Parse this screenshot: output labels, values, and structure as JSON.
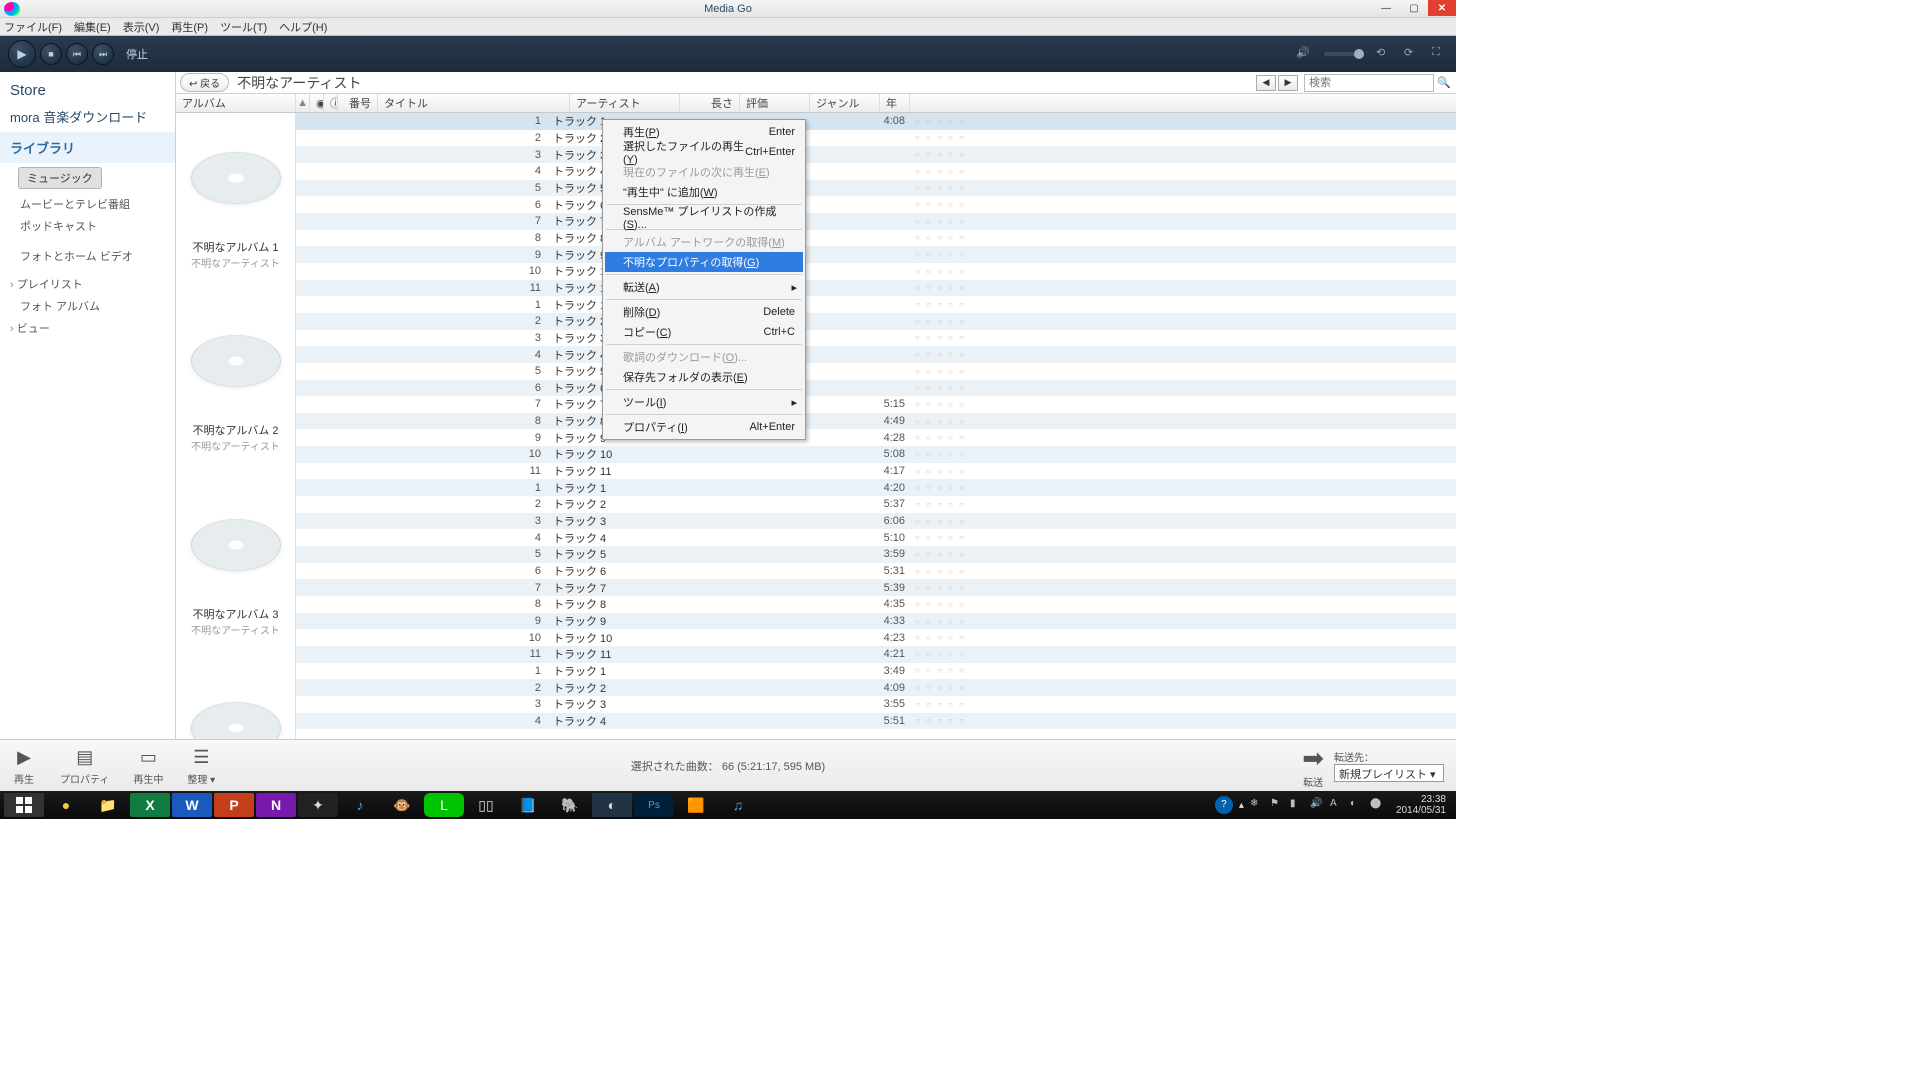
{
  "window": {
    "title": "Media Go"
  },
  "menu": {
    "file": "ファイル(F)",
    "edit": "編集(E)",
    "view": "表示(V)",
    "play": "再生(P)",
    "tool": "ツール(T)",
    "help": "ヘルプ(H)"
  },
  "player": {
    "status": "停止"
  },
  "sidebar": {
    "store": "Store",
    "mora": "mora 音楽ダウンロード",
    "library": "ライブラリ",
    "music": "ミュージック",
    "items": [
      "ムービーとテレビ番組",
      "ポッドキャスト",
      "",
      "フォトとホーム ビデオ"
    ],
    "exp": [
      "プレイリスト",
      "フォト アルバム",
      "ビュー"
    ]
  },
  "breadcrumb": {
    "back": "↩ 戻る",
    "artist": "不明なアーティスト",
    "search_ph": "検索"
  },
  "columns": {
    "album": "アルバム",
    "num": "番号",
    "title": "タイトル",
    "artist": "アーティスト",
    "len": "長さ",
    "rating": "評価",
    "genre": "ジャンル",
    "year": "年"
  },
  "albums": [
    {
      "name": "不明なアルバム 1",
      "artist": "不明なアーティスト",
      "tracks": [
        {
          "n": 1,
          "t": "トラック 1",
          "d": "4:08"
        },
        {
          "n": 2,
          "t": "トラック 2",
          "d": ""
        },
        {
          "n": 3,
          "t": "トラック 3",
          "d": ""
        },
        {
          "n": 4,
          "t": "トラック 4",
          "d": ""
        },
        {
          "n": 5,
          "t": "トラック 5",
          "d": ""
        },
        {
          "n": 6,
          "t": "トラック 6",
          "d": ""
        },
        {
          "n": 7,
          "t": "トラック 7",
          "d": ""
        },
        {
          "n": 8,
          "t": "トラック 8",
          "d": ""
        },
        {
          "n": 9,
          "t": "トラック 9",
          "d": ""
        },
        {
          "n": 10,
          "t": "トラック 10",
          "d": ""
        },
        {
          "n": 11,
          "t": "トラック 11",
          "d": ""
        }
      ]
    },
    {
      "name": "不明なアルバム 2",
      "artist": "不明なアーティスト",
      "tracks": [
        {
          "n": 1,
          "t": "トラック 1",
          "d": ""
        },
        {
          "n": 2,
          "t": "トラック 2",
          "d": ""
        },
        {
          "n": 3,
          "t": "トラック 3",
          "d": ""
        },
        {
          "n": 4,
          "t": "トラック 4",
          "d": ""
        },
        {
          "n": 5,
          "t": "トラック 5",
          "d": ""
        },
        {
          "n": 6,
          "t": "トラック 6",
          "d": ""
        },
        {
          "n": 7,
          "t": "トラック 7",
          "d": "5:15"
        },
        {
          "n": 8,
          "t": "トラック 8",
          "d": "4:49"
        },
        {
          "n": 9,
          "t": "トラック 9",
          "d": "4:28"
        },
        {
          "n": 10,
          "t": "トラック 10",
          "d": "5:08"
        },
        {
          "n": 11,
          "t": "トラック 11",
          "d": "4:17"
        }
      ]
    },
    {
      "name": "不明なアルバム 3",
      "artist": "不明なアーティスト",
      "tracks": [
        {
          "n": 1,
          "t": "トラック 1",
          "d": "4:20"
        },
        {
          "n": 2,
          "t": "トラック 2",
          "d": "5:37"
        },
        {
          "n": 3,
          "t": "トラック 3",
          "d": "6:06"
        },
        {
          "n": 4,
          "t": "トラック 4",
          "d": "5:10"
        },
        {
          "n": 5,
          "t": "トラック 5",
          "d": "3:59"
        },
        {
          "n": 6,
          "t": "トラック 6",
          "d": "5:31"
        },
        {
          "n": 7,
          "t": "トラック 7",
          "d": "5:39"
        },
        {
          "n": 8,
          "t": "トラック 8",
          "d": "4:35"
        },
        {
          "n": 9,
          "t": "トラック 9",
          "d": "4:33"
        },
        {
          "n": 10,
          "t": "トラック 10",
          "d": "4:23"
        },
        {
          "n": 11,
          "t": "トラック 11",
          "d": "4:21"
        }
      ]
    },
    {
      "name": "",
      "artist": "",
      "tracks": [
        {
          "n": 1,
          "t": "トラック 1",
          "d": "3:49"
        },
        {
          "n": 2,
          "t": "トラック 2",
          "d": "4:09"
        },
        {
          "n": 3,
          "t": "トラック 3",
          "d": "3:55"
        },
        {
          "n": 4,
          "t": "トラック 4",
          "d": "5:51"
        }
      ]
    }
  ],
  "context_menu": {
    "items": [
      {
        "label": "再生(<u>P</u>)",
        "shortcut": "Enter"
      },
      {
        "label": "選択したファイルの再生(<u>Y</u>)",
        "shortcut": "Ctrl+Enter"
      },
      {
        "label": "現在のファイルの次に再生(<u>E</u>)",
        "disabled": true
      },
      {
        "label": "\"再生中\" に追加(<u>W</u>)"
      },
      {
        "sep": true
      },
      {
        "label": "SensMe™ プレイリストの作成(<u>S</u>)..."
      },
      {
        "sep": true
      },
      {
        "label": "アルバム アートワークの取得(<u>M</u>)",
        "disabled": true
      },
      {
        "label": "不明なプロパティの取得(<u>G</u>)",
        "hl": true
      },
      {
        "sep": true
      },
      {
        "label": "転送(<u>A</u>)",
        "arrow": true
      },
      {
        "sep": true
      },
      {
        "label": "削除(<u>D</u>)",
        "shortcut": "Delete"
      },
      {
        "label": "コピー(<u>C</u>)",
        "shortcut": "Ctrl+C"
      },
      {
        "sep": true
      },
      {
        "label": "歌詞のダウンロード(<u>O</u>)...",
        "disabled": true
      },
      {
        "label": "保存先フォルダの表示(<u>E</u>)"
      },
      {
        "sep": true
      },
      {
        "label": "ツール(<u>I</u>)",
        "arrow": true
      },
      {
        "sep": true
      },
      {
        "label": "プロパティ(<u>I</u>)",
        "shortcut": "Alt+Enter"
      }
    ]
  },
  "bottom": {
    "play": "再生",
    "prop": "プロパティ",
    "now": "再生中",
    "org": "整理",
    "status": "選択された曲数： 66 (5:21:17, 595 MB)",
    "transfer": "転送",
    "dest_label": "転送先：",
    "dest": "新規プレイリスト"
  },
  "taskbar": {
    "time": "23:38",
    "date": "2014/05/31"
  }
}
